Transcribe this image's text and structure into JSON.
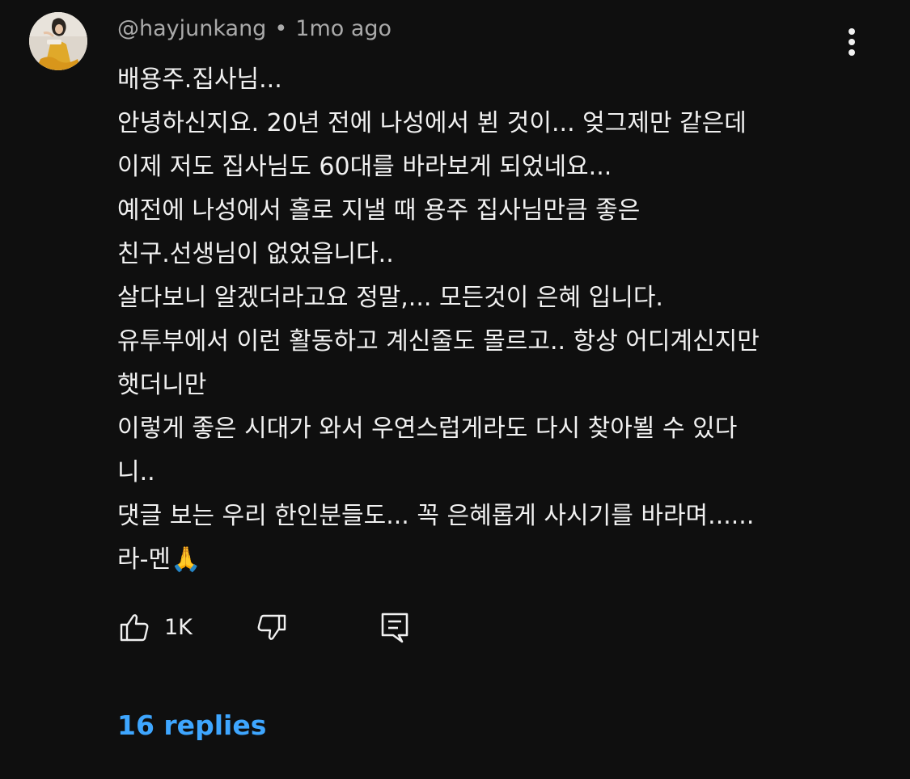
{
  "comment": {
    "author": "@hayjunkang",
    "separator": "•",
    "timestamp": "1mo ago",
    "lines": [
      "배용주.집사님...",
      "안녕하신지요. 20년 전에 나성에서 뵌 것이... 엊그제만 같은데",
      "이제 저도 집사님도 60대를 바라보게 되었네요...",
      "예전에 나성에서 홀로 지낼 때 용주 집사님만큼 좋은",
      "친구.선생님이 없었읍니다..",
      "살다보니 알겠더라고요 정말,... 모든것이 은혜 입니다.",
      "유투부에서 이런 활동하고 계신줄도 몰르고.. 항상 어디계신지만",
      "햇더니만",
      "이렇게 좋은 시대가 와서 우연스럽게라도 다시 찾아뵐 수 있다",
      "니..",
      "댓글 보는 우리 한인분들도... 꼭 은혜롭게 사시기를 바라며......",
      "라-멘🙏"
    ],
    "like_count": "1K",
    "replies_label": "16 replies"
  },
  "icons": {
    "more": "more-vert-icon",
    "like": "thumb-up-icon",
    "dislike": "thumb-down-icon",
    "reply": "comment-reply-icon"
  },
  "colors": {
    "background": "#0f0f0f",
    "text": "#f1f1f1",
    "meta": "#aaaaaa",
    "link": "#3ea6ff"
  }
}
